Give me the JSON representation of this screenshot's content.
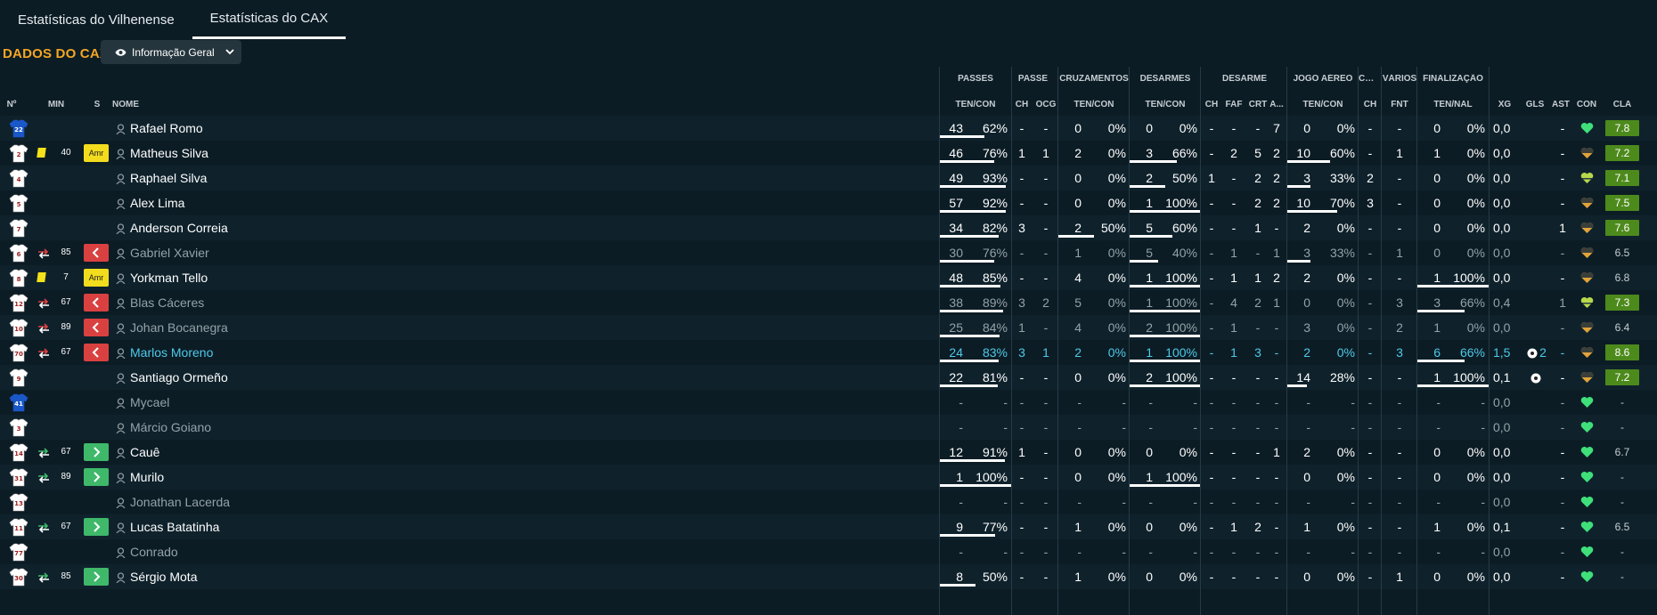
{
  "tabs": [
    {
      "label": "Estatísticas do Vilhenense"
    },
    {
      "label": "Estatísticas do CAX"
    }
  ],
  "page": {
    "title": "DADOS DO CAX",
    "view_label": "Informação Geral"
  },
  "groups": {
    "passes": "PASSES",
    "passe": "PASSE",
    "cruz": "CRUZAMENTOS",
    "des1": "DESARMES",
    "des2": "DESARME",
    "aereo": "JOGO AÉREO",
    "ca": "CA...",
    "varios": "VÁRIOS",
    "final": "FINALIZAÇÃO"
  },
  "cols": {
    "no": "Nº",
    "min": "MIN",
    "s": "S",
    "nome": "NOME",
    "ps_tc": "TEN/CON",
    "pe_ch": "CH",
    "pe_ocg": "OCG",
    "cr_tc": "TEN/CON",
    "de_tc": "TEN/CON",
    "d_ch": "CH",
    "d_faf": "FAF",
    "d_crt": "CRT",
    "d_a": "A...",
    "ja_tc": "TEN/CON",
    "ca_ch": "CH",
    "v_fnt": "FNT",
    "f_tn": "TEN/NAL",
    "xg": "XG",
    "gls": "GLS",
    "ast": "AST",
    "con": "CON",
    "cla": "CLA"
  },
  "colors": {
    "accent": "#f5a623",
    "highlight": "#4ec9e8",
    "rating_bg": "#4d8a1c",
    "yellow_card": "#f4e21a",
    "sub_out": "#d94141",
    "sub_in": "#3fb86a",
    "condition": "#3fe07a"
  },
  "rows": [
    {
      "n": "22",
      "gk": true,
      "ev": "",
      "min": "",
      "b": "",
      "name": "Rafael Romo",
      "st": "",
      "p": [
        "43",
        "62%"
      ],
      "pb": 0.62,
      "ch": "-",
      "ocg": "-",
      "c": [
        "0",
        "0%"
      ],
      "cb": 0,
      "d": [
        "0",
        "0%"
      ],
      "db": 0,
      "dch": "-",
      "faf": "-",
      "crt": "-",
      "da": "7",
      "a": [
        "0",
        "0%"
      ],
      "ab": 0,
      "cach": "-",
      "fnt": "-",
      "f": [
        "0",
        "0%"
      ],
      "fb": 0,
      "xg": "0,0",
      "gls": "",
      "ast": "-",
      "cond": "full",
      "cla": "7.8",
      "cg": true
    },
    {
      "n": "2",
      "gk": false,
      "ev": "yellow",
      "min": "40",
      "b": "amr",
      "name": "Matheus Silva",
      "st": "",
      "p": [
        "46",
        "76%"
      ],
      "pb": 0.76,
      "ch": "1",
      "ocg": "1",
      "c": [
        "2",
        "0%"
      ],
      "cb": 0,
      "d": [
        "3",
        "66%"
      ],
      "db": 0.66,
      "dch": "-",
      "faf": "2",
      "crt": "5",
      "da": "2",
      "a": [
        "10",
        "60%"
      ],
      "ab": 0.6,
      "cach": "-",
      "fnt": "1",
      "f": [
        "1",
        "0%"
      ],
      "fb": 0,
      "xg": "0,0",
      "gls": "",
      "ast": "-",
      "cond": "half",
      "cla": "7.2",
      "cg": true
    },
    {
      "n": "4",
      "gk": false,
      "ev": "",
      "min": "",
      "b": "",
      "name": "Raphael Silva",
      "st": "",
      "p": [
        "49",
        "93%"
      ],
      "pb": 0.93,
      "ch": "-",
      "ocg": "-",
      "c": [
        "0",
        "0%"
      ],
      "cb": 0,
      "d": [
        "2",
        "50%"
      ],
      "db": 0.5,
      "dch": "1",
      "faf": "-",
      "crt": "2",
      "da": "2",
      "a": [
        "3",
        "33%"
      ],
      "ab": 0.33,
      "cach": "2",
      "fnt": "-",
      "f": [
        "0",
        "0%"
      ],
      "fb": 0,
      "xg": "0,0",
      "gls": "",
      "ast": "-",
      "cond": "high",
      "cla": "7.1",
      "cg": true
    },
    {
      "n": "5",
      "gk": false,
      "ev": "",
      "min": "",
      "b": "",
      "name": "Alex Lima",
      "st": "",
      "p": [
        "57",
        "92%"
      ],
      "pb": 0.92,
      "ch": "-",
      "ocg": "-",
      "c": [
        "0",
        "0%"
      ],
      "cb": 0,
      "d": [
        "1",
        "100%"
      ],
      "db": 1,
      "dch": "-",
      "faf": "-",
      "crt": "2",
      "da": "2",
      "a": [
        "10",
        "70%"
      ],
      "ab": 0.7,
      "cach": "3",
      "fnt": "-",
      "f": [
        "0",
        "0%"
      ],
      "fb": 0,
      "xg": "0,0",
      "gls": "",
      "ast": "-",
      "cond": "half",
      "cla": "7.5",
      "cg": true
    },
    {
      "n": "7",
      "gk": false,
      "ev": "",
      "min": "",
      "b": "",
      "name": "Anderson Correia",
      "st": "",
      "p": [
        "34",
        "82%"
      ],
      "pb": 0.82,
      "ch": "3",
      "ocg": "-",
      "c": [
        "2",
        "50%"
      ],
      "cb": 0.5,
      "d": [
        "5",
        "60%"
      ],
      "db": 0.6,
      "dch": "-",
      "faf": "-",
      "crt": "1",
      "da": "-",
      "a": [
        "2",
        "0%"
      ],
      "ab": 0,
      "cach": "-",
      "fnt": "-",
      "f": [
        "0",
        "0%"
      ],
      "fb": 0,
      "xg": "0,0",
      "gls": "",
      "ast": "1",
      "cond": "half",
      "cla": "7.6",
      "cg": true
    },
    {
      "n": "6",
      "gk": false,
      "ev": "subout",
      "min": "85",
      "b": "out",
      "name": "Gabriel Xavier",
      "st": "dim",
      "p": [
        "30",
        "76%"
      ],
      "pb": 0.76,
      "ch": "-",
      "ocg": "-",
      "c": [
        "1",
        "0%"
      ],
      "cb": 0,
      "d": [
        "5",
        "40%"
      ],
      "db": 0.4,
      "dch": "-",
      "faf": "1",
      "crt": "-",
      "da": "1",
      "a": [
        "3",
        "33%"
      ],
      "ab": 0.33,
      "cach": "-",
      "fnt": "1",
      "f": [
        "0",
        "0%"
      ],
      "fb": 0,
      "xg": "0,0",
      "gls": "",
      "ast": "-",
      "cond": "half",
      "cla": "6.5",
      "cg": false
    },
    {
      "n": "8",
      "gk": false,
      "ev": "yellow",
      "min": "7",
      "b": "amr",
      "name": "Yorkman Tello",
      "st": "",
      "p": [
        "48",
        "85%"
      ],
      "pb": 0.85,
      "ch": "-",
      "ocg": "-",
      "c": [
        "4",
        "0%"
      ],
      "cb": 0,
      "d": [
        "1",
        "100%"
      ],
      "db": 1,
      "dch": "-",
      "faf": "1",
      "crt": "1",
      "da": "2",
      "a": [
        "2",
        "0%"
      ],
      "ab": 0,
      "cach": "-",
      "fnt": "-",
      "f": [
        "1",
        "100%"
      ],
      "fb": 1,
      "xg": "0,0",
      "gls": "",
      "ast": "-",
      "cond": "half",
      "cla": "6.8",
      "cg": false
    },
    {
      "n": "12",
      "gk": false,
      "ev": "subout",
      "min": "67",
      "b": "out",
      "name": "Blas Cáceres",
      "st": "dim",
      "p": [
        "38",
        "89%"
      ],
      "pb": 0.89,
      "ch": "3",
      "ocg": "2",
      "c": [
        "5",
        "0%"
      ],
      "cb": 0,
      "d": [
        "1",
        "100%"
      ],
      "db": 1,
      "dch": "-",
      "faf": "4",
      "crt": "2",
      "da": "1",
      "a": [
        "0",
        "0%"
      ],
      "ab": 0,
      "cach": "-",
      "fnt": "3",
      "f": [
        "3",
        "66%"
      ],
      "fb": 0.66,
      "xg": "0,4",
      "gls": "",
      "ast": "1",
      "cond": "high",
      "cla": "7.3",
      "cg": true
    },
    {
      "n": "10",
      "gk": false,
      "ev": "subout",
      "min": "89",
      "b": "out",
      "name": "Johan Bocanegra",
      "st": "dim",
      "p": [
        "25",
        "84%"
      ],
      "pb": 0.84,
      "ch": "1",
      "ocg": "-",
      "c": [
        "4",
        "0%"
      ],
      "cb": 0,
      "d": [
        "2",
        "100%"
      ],
      "db": 1,
      "dch": "-",
      "faf": "1",
      "crt": "-",
      "da": "-",
      "a": [
        "3",
        "0%"
      ],
      "ab": 0,
      "cach": "-",
      "fnt": "2",
      "f": [
        "1",
        "0%"
      ],
      "fb": 0,
      "xg": "0,0",
      "gls": "",
      "ast": "-",
      "cond": "half",
      "cla": "6.4",
      "cg": false
    },
    {
      "n": "70",
      "gk": false,
      "ev": "subout",
      "min": "67",
      "b": "out",
      "name": "Marlos Moreno",
      "st": "hl",
      "p": [
        "24",
        "83%"
      ],
      "pb": 0.83,
      "ch": "3",
      "ocg": "1",
      "c": [
        "2",
        "0%"
      ],
      "cb": 0,
      "d": [
        "1",
        "100%"
      ],
      "db": 1,
      "dch": "-",
      "faf": "1",
      "crt": "3",
      "da": "-",
      "a": [
        "2",
        "0%"
      ],
      "ab": 0,
      "cach": "-",
      "fnt": "3",
      "f": [
        "6",
        "66%"
      ],
      "fb": 0.66,
      "xg": "1,5",
      "gls": "2",
      "ast": "-",
      "cond": "half",
      "cla": "8.6",
      "cg": true
    },
    {
      "n": "9",
      "gk": false,
      "ev": "",
      "min": "",
      "b": "",
      "name": "Santiago Ormeño",
      "st": "",
      "p": [
        "22",
        "81%"
      ],
      "pb": 0.81,
      "ch": "-",
      "ocg": "-",
      "c": [
        "0",
        "0%"
      ],
      "cb": 0,
      "d": [
        "2",
        "100%"
      ],
      "db": 1,
      "dch": "-",
      "faf": "-",
      "crt": "-",
      "da": "-",
      "a": [
        "14",
        "28%"
      ],
      "ab": 0.28,
      "cach": "-",
      "fnt": "-",
      "f": [
        "1",
        "100%"
      ],
      "fb": 1,
      "xg": "0,1",
      "gls": "ball",
      "ast": "-",
      "cond": "half",
      "cla": "7.2",
      "cg": true
    },
    {
      "n": "41",
      "gk": true,
      "ev": "",
      "min": "",
      "b": "",
      "name": "Mycael",
      "st": "dim",
      "p": [
        "-",
        "-"
      ],
      "pb": 0,
      "ch": "-",
      "ocg": "-",
      "c": [
        "-",
        "-"
      ],
      "cb": 0,
      "d": [
        "-",
        "-"
      ],
      "db": 0,
      "dch": "-",
      "faf": "-",
      "crt": "-",
      "da": "-",
      "a": [
        "-",
        "-"
      ],
      "ab": 0,
      "cach": "-",
      "fnt": "-",
      "f": [
        "-",
        "-"
      ],
      "fb": 0,
      "xg": "0,0",
      "gls": "",
      "ast": "-",
      "cond": "full",
      "cla": "-",
      "cg": false
    },
    {
      "n": "3",
      "gk": false,
      "ev": "",
      "min": "",
      "b": "",
      "name": "Márcio Goiano",
      "st": "dim",
      "p": [
        "-",
        "-"
      ],
      "pb": 0,
      "ch": "-",
      "ocg": "-",
      "c": [
        "-",
        "-"
      ],
      "cb": 0,
      "d": [
        "-",
        "-"
      ],
      "db": 0,
      "dch": "-",
      "faf": "-",
      "crt": "-",
      "da": "-",
      "a": [
        "-",
        "-"
      ],
      "ab": 0,
      "cach": "-",
      "fnt": "-",
      "f": [
        "-",
        "-"
      ],
      "fb": 0,
      "xg": "0,0",
      "gls": "",
      "ast": "-",
      "cond": "full",
      "cla": "-",
      "cg": false
    },
    {
      "n": "14",
      "gk": false,
      "ev": "subin",
      "min": "67",
      "b": "in",
      "name": "Cauê",
      "st": "",
      "p": [
        "12",
        "91%"
      ],
      "pb": 0.91,
      "ch": "1",
      "ocg": "-",
      "c": [
        "0",
        "0%"
      ],
      "cb": 0,
      "d": [
        "0",
        "0%"
      ],
      "db": 0,
      "dch": "-",
      "faf": "-",
      "crt": "-",
      "da": "1",
      "a": [
        "2",
        "0%"
      ],
      "ab": 0,
      "cach": "-",
      "fnt": "-",
      "f": [
        "0",
        "0%"
      ],
      "fb": 0,
      "xg": "0,0",
      "gls": "",
      "ast": "-",
      "cond": "full",
      "cla": "6.7",
      "cg": false
    },
    {
      "n": "31",
      "gk": false,
      "ev": "subin",
      "min": "89",
      "b": "in",
      "name": "Murilo",
      "st": "",
      "p": [
        "1",
        "100%"
      ],
      "pb": 1,
      "ch": "-",
      "ocg": "-",
      "c": [
        "0",
        "0%"
      ],
      "cb": 0,
      "d": [
        "1",
        "100%"
      ],
      "db": 1,
      "dch": "-",
      "faf": "-",
      "crt": "-",
      "da": "-",
      "a": [
        "0",
        "0%"
      ],
      "ab": 0,
      "cach": "-",
      "fnt": "-",
      "f": [
        "0",
        "0%"
      ],
      "fb": 0,
      "xg": "0,0",
      "gls": "",
      "ast": "-",
      "cond": "full",
      "cla": "-",
      "cg": false
    },
    {
      "n": "13",
      "gk": false,
      "ev": "",
      "min": "",
      "b": "",
      "name": "Jonathan Lacerda",
      "st": "dim",
      "p": [
        "-",
        "-"
      ],
      "pb": 0,
      "ch": "-",
      "ocg": "-",
      "c": [
        "-",
        "-"
      ],
      "cb": 0,
      "d": [
        "-",
        "-"
      ],
      "db": 0,
      "dch": "-",
      "faf": "-",
      "crt": "-",
      "da": "-",
      "a": [
        "-",
        "-"
      ],
      "ab": 0,
      "cach": "-",
      "fnt": "-",
      "f": [
        "-",
        "-"
      ],
      "fb": 0,
      "xg": "0,0",
      "gls": "",
      "ast": "-",
      "cond": "full",
      "cla": "-",
      "cg": false
    },
    {
      "n": "11",
      "gk": false,
      "ev": "subin",
      "min": "67",
      "b": "in",
      "name": "Lucas Batatinha",
      "st": "",
      "p": [
        "9",
        "77%"
      ],
      "pb": 0.77,
      "ch": "-",
      "ocg": "-",
      "c": [
        "1",
        "0%"
      ],
      "cb": 0,
      "d": [
        "0",
        "0%"
      ],
      "db": 0,
      "dch": "-",
      "faf": "1",
      "crt": "2",
      "da": "-",
      "a": [
        "1",
        "0%"
      ],
      "ab": 0,
      "cach": "-",
      "fnt": "-",
      "f": [
        "1",
        "0%"
      ],
      "fb": 0,
      "xg": "0,1",
      "gls": "",
      "ast": "-",
      "cond": "full",
      "cla": "6.5",
      "cg": false
    },
    {
      "n": "77",
      "gk": false,
      "ev": "",
      "min": "",
      "b": "",
      "name": "Conrado",
      "st": "dim",
      "p": [
        "-",
        "-"
      ],
      "pb": 0,
      "ch": "-",
      "ocg": "-",
      "c": [
        "-",
        "-"
      ],
      "cb": 0,
      "d": [
        "-",
        "-"
      ],
      "db": 0,
      "dch": "-",
      "faf": "-",
      "crt": "-",
      "da": "-",
      "a": [
        "-",
        "-"
      ],
      "ab": 0,
      "cach": "-",
      "fnt": "-",
      "f": [
        "-",
        "-"
      ],
      "fb": 0,
      "xg": "0,0",
      "gls": "",
      "ast": "-",
      "cond": "full",
      "cla": "-",
      "cg": false
    },
    {
      "n": "30",
      "gk": false,
      "ev": "subin",
      "min": "85",
      "b": "in",
      "name": "Sérgio Mota",
      "st": "",
      "p": [
        "8",
        "50%"
      ],
      "pb": 0.5,
      "ch": "-",
      "ocg": "-",
      "c": [
        "1",
        "0%"
      ],
      "cb": 0,
      "d": [
        "0",
        "0%"
      ],
      "db": 0,
      "dch": "-",
      "faf": "-",
      "crt": "-",
      "da": "-",
      "a": [
        "0",
        "0%"
      ],
      "ab": 0,
      "cach": "-",
      "fnt": "1",
      "f": [
        "0",
        "0%"
      ],
      "fb": 0,
      "xg": "0,0",
      "gls": "",
      "ast": "-",
      "cond": "full",
      "cla": "-",
      "cg": false
    }
  ],
  "badges": {
    "amr": "Amr"
  }
}
